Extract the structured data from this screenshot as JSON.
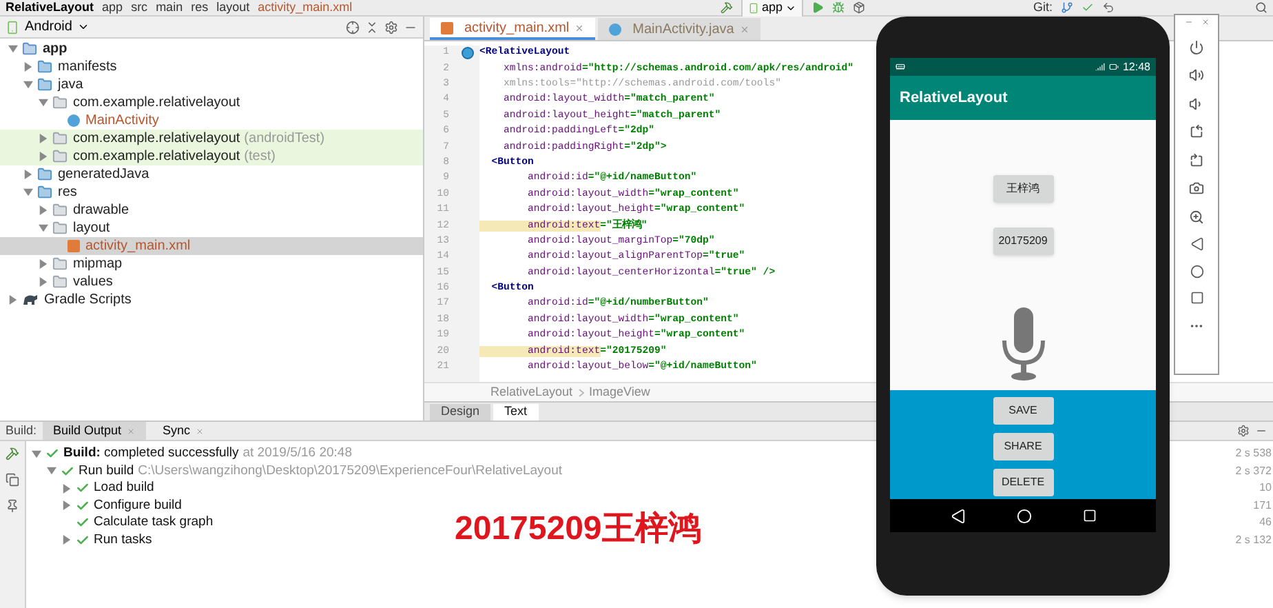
{
  "top_bar": {
    "breadcrumbs": [
      "RelativeLayout",
      "app",
      "src",
      "main",
      "res",
      "layout",
      "activity_main.xml"
    ],
    "run_config": "app",
    "vcs_label": "Git:"
  },
  "project_panel": {
    "view": "Android",
    "tree": [
      {
        "label": "app",
        "kind": "module",
        "expanded": true,
        "selected": false,
        "test_source": false,
        "children": [
          {
            "label": "manifests",
            "kind": "folder",
            "expanded": false,
            "selected": false,
            "test_source": false
          },
          {
            "label": "java",
            "kind": "folder",
            "expanded": true,
            "selected": false,
            "test_source": false,
            "children": [
              {
                "label": "com.example.relativelayout",
                "kind": "package",
                "expanded": true,
                "selected": false,
                "test_source": false,
                "children": [
                  {
                    "label": "MainActivity",
                    "kind": "class",
                    "selected": false,
                    "test_source": false
                  }
                ]
              },
              {
                "label": "com.example.relativelayout",
                "suffix": "(androidTest)",
                "kind": "package",
                "expanded": false,
                "selected": false,
                "test_source": true
              },
              {
                "label": "com.example.relativelayout",
                "suffix": "(test)",
                "kind": "package",
                "expanded": false,
                "selected": false,
                "test_source": true
              }
            ]
          },
          {
            "label": "generatedJava",
            "kind": "folder",
            "expanded": false,
            "selected": false,
            "test_source": false
          },
          {
            "label": "res",
            "kind": "folder",
            "expanded": true,
            "selected": false,
            "test_source": false,
            "children": [
              {
                "label": "drawable",
                "kind": "package",
                "expanded": false,
                "selected": false,
                "test_source": false
              },
              {
                "label": "layout",
                "kind": "package",
                "expanded": true,
                "selected": false,
                "test_source": false,
                "children": [
                  {
                    "label": "activity_main.xml",
                    "kind": "xml",
                    "selected": true,
                    "test_source": false
                  }
                ]
              },
              {
                "label": "mipmap",
                "kind": "package",
                "expanded": false,
                "selected": false,
                "test_source": false
              },
              {
                "label": "values",
                "kind": "package",
                "expanded": false,
                "selected": false,
                "test_source": false
              }
            ]
          }
        ]
      },
      {
        "label": "Gradle Scripts",
        "kind": "gradle",
        "expanded": false,
        "selected": false,
        "test_source": false
      }
    ]
  },
  "editor": {
    "tabs": [
      {
        "label": "activity_main.xml",
        "kind": "xml",
        "selected": true
      },
      {
        "label": "MainActivity.java",
        "kind": "class",
        "selected": false
      }
    ],
    "lines": [
      {
        "number": "1",
        "text": "<RelativeLayout",
        "highlighted": false,
        "dimmed": false
      },
      {
        "number": "2",
        "text": "    xmlns:android=\"http://schemas.android.com/apk/res/android\"",
        "highlighted": false,
        "dimmed": false
      },
      {
        "number": "3",
        "text": "    xmlns:tools=\"http://schemas.android.com/tools\"",
        "highlighted": false,
        "dimmed": true
      },
      {
        "number": "4",
        "text": "    android:layout_width=\"match_parent\"",
        "highlighted": false,
        "dimmed": false
      },
      {
        "number": "5",
        "text": "    android:layout_height=\"match_parent\"",
        "highlighted": false,
        "dimmed": false
      },
      {
        "number": "6",
        "text": "    android:paddingLeft=\"2dp\"",
        "highlighted": false,
        "dimmed": false
      },
      {
        "number": "7",
        "text": "    android:paddingRight=\"2dp\">",
        "highlighted": false,
        "dimmed": false
      },
      {
        "number": "8",
        "text": "  <Button",
        "highlighted": false,
        "dimmed": false
      },
      {
        "number": "9",
        "text": "        android:id=\"@+id/nameButton\"",
        "highlighted": false,
        "dimmed": false
      },
      {
        "number": "10",
        "text": "        android:layout_width=\"wrap_content\"",
        "highlighted": false,
        "dimmed": false
      },
      {
        "number": "11",
        "text": "        android:layout_height=\"wrap_content\"",
        "highlighted": false,
        "dimmed": false
      },
      {
        "number": "12",
        "text": "        android:text=\"王梓鸿\"",
        "highlighted": true,
        "dimmed": false
      },
      {
        "number": "13",
        "text": "        android:layout_marginTop=\"70dp\"",
        "highlighted": false,
        "dimmed": false
      },
      {
        "number": "14",
        "text": "        android:layout_alignParentTop=\"true\"",
        "highlighted": false,
        "dimmed": false
      },
      {
        "number": "15",
        "text": "        android:layout_centerHorizontal=\"true\" />",
        "highlighted": false,
        "dimmed": false
      },
      {
        "number": "16",
        "text": "  <Button",
        "highlighted": false,
        "dimmed": false
      },
      {
        "number": "17",
        "text": "        android:id=\"@+id/numberButton\"",
        "highlighted": false,
        "dimmed": false
      },
      {
        "number": "18",
        "text": "        android:layout_width=\"wrap_content\"",
        "highlighted": false,
        "dimmed": false
      },
      {
        "number": "19",
        "text": "        android:layout_height=\"wrap_content\"",
        "highlighted": false,
        "dimmed": false
      },
      {
        "number": "20",
        "text": "        android:text=\"20175209\"",
        "highlighted": true,
        "dimmed": false
      },
      {
        "number": "21",
        "text": "        android:layout_below=\"@+id/nameButton\"",
        "highlighted": false,
        "dimmed": false
      }
    ],
    "breadcrumbs": [
      "RelativeLayout",
      "ImageView"
    ],
    "mode_tabs": [
      {
        "label": "Design",
        "selected": false
      },
      {
        "label": "Text",
        "selected": true
      }
    ]
  },
  "build_panel": {
    "label": "Build:",
    "tabs": [
      {
        "label": "Build Output",
        "selected": true
      },
      {
        "label": "Sync",
        "selected": false
      }
    ],
    "tree": [
      {
        "text": "**Build:** completed successfully",
        "detail": "at 2019/5/16 20:48",
        "expanded": true,
        "children": [
          {
            "text": "Run build",
            "detail": "C:\\Users\\wangzihong\\Desktop\\20175209\\ExperienceFour\\RelativeLayout",
            "expanded": true,
            "children": [
              {
                "text": "Load build",
                "expanded": false
              },
              {
                "text": "Configure build",
                "expanded": false
              },
              {
                "text": "Calculate task graph"
              },
              {
                "text": "Run tasks",
                "expanded": false
              }
            ]
          }
        ]
      }
    ],
    "timings": [
      "2 s 538",
      "2 s 372",
      "10",
      "171",
      "46",
      "2 s 132"
    ]
  },
  "caption": "20175209王梓鸿",
  "phone": {
    "time": "12:48",
    "app_title": "RelativeLayout",
    "top_buttons": [
      "王梓鸿",
      "20175209"
    ],
    "bottom_buttons": [
      "SAVE",
      "SHARE",
      "DELETE"
    ]
  }
}
